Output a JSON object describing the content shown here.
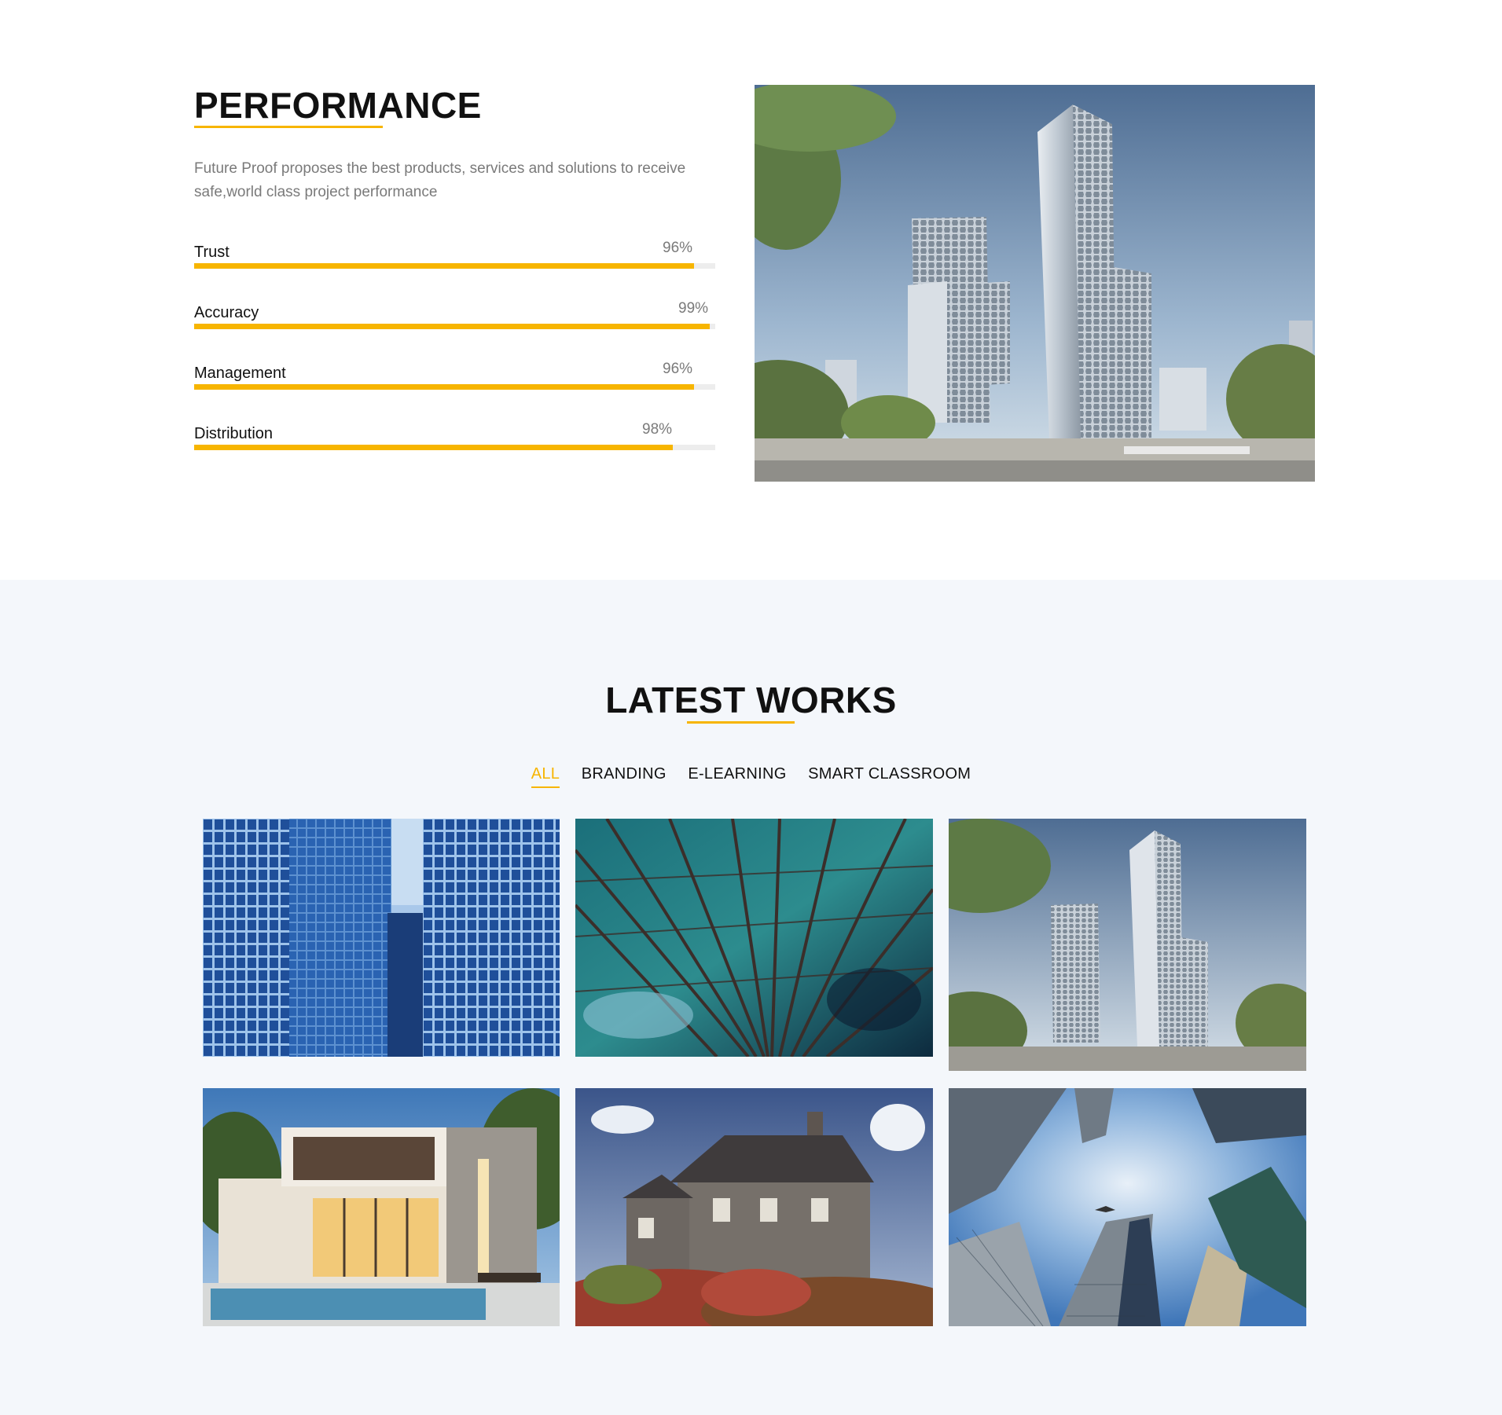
{
  "performance": {
    "title": "PERFORMANCE",
    "description": "Future Proof proposes the best products, services and solutions to receive safe,world class project performance",
    "skills": [
      {
        "label": "Trust",
        "percent_text": "96%",
        "percent": 96
      },
      {
        "label": "Accuracy",
        "percent_text": "99%",
        "percent": 99
      },
      {
        "label": "Management",
        "percent_text": "96%",
        "percent": 96
      },
      {
        "label": "Distribution",
        "percent_text": "98%",
        "percent": 98
      }
    ],
    "image": "twin-towers-image"
  },
  "works": {
    "title": "LATEST WORKS",
    "filters": [
      {
        "label": "ALL",
        "active": true
      },
      {
        "label": "BRANDING",
        "active": false
      },
      {
        "label": "E-LEARNING",
        "active": false
      },
      {
        "label": "SMART CLASSROOM",
        "active": false
      }
    ],
    "gallery": [
      "blue-glass-skyscrapers-image",
      "reflective-tower-facade-image",
      "twin-towers-image",
      "modern-villa-pool-image",
      "stone-house-image",
      "skyscrapers-looking-up-image"
    ]
  },
  "colors": {
    "accent": "#f7b500",
    "works_bg": "#f4f7fb",
    "muted_text": "#7a7a7a"
  }
}
